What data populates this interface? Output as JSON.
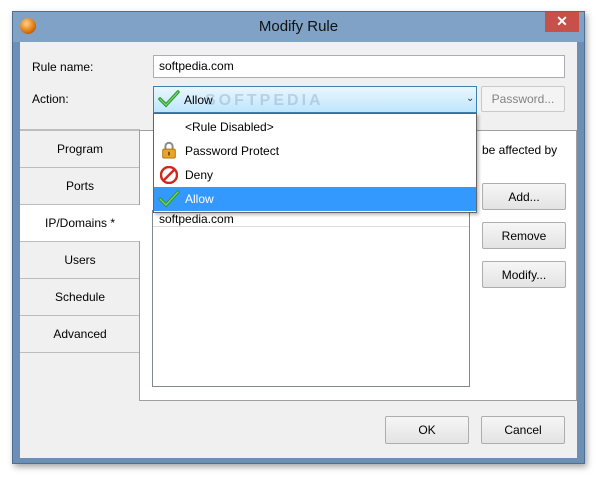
{
  "window": {
    "title": "Modify Rule",
    "close_glyph": "✕",
    "accent": "#7fa2c6"
  },
  "form": {
    "rule_name_label": "Rule name:",
    "rule_name_value": "softpedia.com",
    "action_label": "Action:",
    "action_value": "Allow",
    "password_button": "Password..."
  },
  "dropdown": {
    "options": [
      {
        "label": "<Rule Disabled>",
        "icon": "none"
      },
      {
        "label": "Password Protect",
        "icon": "lock-icon"
      },
      {
        "label": "Deny",
        "icon": "deny-icon"
      },
      {
        "label": "Allow",
        "icon": "check-icon",
        "selected": true
      }
    ]
  },
  "tabs": [
    "Program",
    "Ports",
    "IP/Domains *",
    "Users",
    "Schedule",
    "Advanced"
  ],
  "panel": {
    "description_fragment": "be affected by",
    "list_items": [
      "softpedia.com"
    ],
    "add_button": "Add...",
    "remove_button": "Remove",
    "modify_button": "Modify..."
  },
  "footer": {
    "ok_button": "OK",
    "cancel_button": "Cancel"
  },
  "watermark": "SOFTPEDIA"
}
